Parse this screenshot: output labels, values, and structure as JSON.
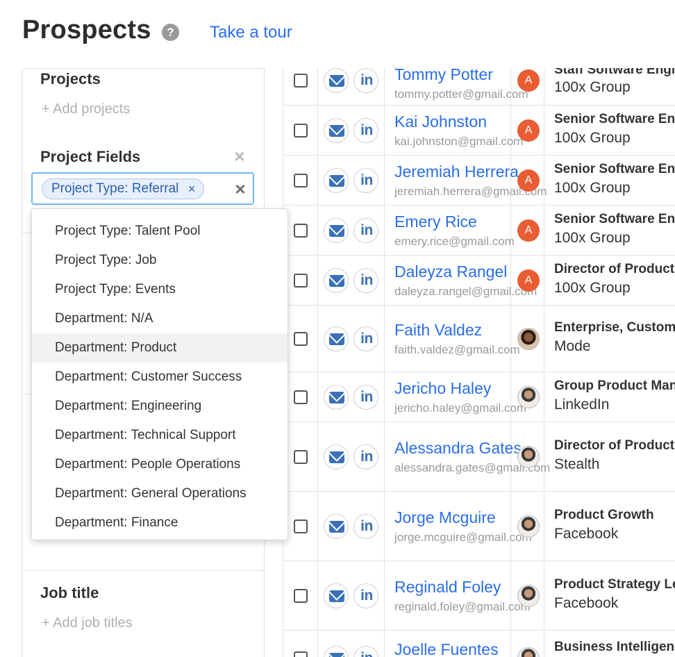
{
  "header": {
    "title": "Prospects",
    "help_icon": "question-circle-icon",
    "tour_link": "Take a tour"
  },
  "filters": {
    "projects": {
      "title": "Projects",
      "add_label": "+ Add projects"
    },
    "project_fields": {
      "title": "Project Fields",
      "clear_icon": "close-icon",
      "selected_chip": "Project Type: Referral",
      "chip_remove": "×",
      "input_clear": "×"
    },
    "job_title": {
      "title": "Job title",
      "add_label": "+ Add job titles"
    }
  },
  "dropdown": {
    "options": [
      "Project Type: Talent Pool",
      "Project Type: Job",
      "Project Type: Events",
      "Department: N/A",
      "Department: Product",
      "Department: Customer Success",
      "Department: Engineering",
      "Department: Technical Support",
      "Department: People Operations",
      "Department: General Operations",
      "Department: Finance"
    ],
    "highlighted_index": 4
  },
  "table": {
    "email_icon": "envelope-icon",
    "linkedin_icon": "linkedin-icon",
    "linkedin_text": "in",
    "rows": [
      {
        "name": "Tommy Potter",
        "email": "tommy.potter@gmail.com",
        "avatar": "A",
        "title": "Staff Software Engineer",
        "company": "100x Group"
      },
      {
        "name": "Kai Johnston",
        "email": "kai.johnston@gmail.com",
        "avatar": "A",
        "title": "Senior Software Engineer",
        "company": "100x Group"
      },
      {
        "name": "Jeremiah Herrera",
        "email": "jeremiah.herrera@gmail.com",
        "avatar": "A",
        "title": "Senior Software Engineer",
        "company": "100x Group"
      },
      {
        "name": "Emery Rice",
        "email": "emery.rice@gmail.com",
        "avatar": "A",
        "title": "Senior Software Engineer",
        "company": "100x Group"
      },
      {
        "name": "Daleyza Rangel",
        "email": "daleyza.rangel@gmail.com",
        "avatar": "A",
        "title": "Director of Product",
        "company": "100x Group"
      },
      {
        "name": "Faith Valdez",
        "email": "faith.valdez@gmail.com",
        "avatar": "photo",
        "title": "Enterprise, Customer",
        "company": "Mode"
      },
      {
        "name": "Jericho Haley",
        "email": "jericho.haley@gmail.com",
        "avatar": "photo",
        "title": "Group Product Manager",
        "company": "LinkedIn"
      },
      {
        "name": "Alessandra Gates",
        "email": "alessandra.gates@gmail.com",
        "avatar": "photo",
        "title": "Director of Product",
        "company": "Stealth"
      },
      {
        "name": "Jorge Mcguire",
        "email": "jorge.mcguire@gmail.com",
        "avatar": "photo",
        "title": "Product Growth",
        "company": "Facebook"
      },
      {
        "name": "Reginald Foley",
        "email": "reginald.foley@gmail.com",
        "avatar": "photo",
        "title": "Product Strategy Lead",
        "company": "Facebook"
      },
      {
        "name": "Joelle Fuentes",
        "email": "",
        "avatar": "photo",
        "title": "Business Intelligence",
        "company": ""
      }
    ]
  }
}
